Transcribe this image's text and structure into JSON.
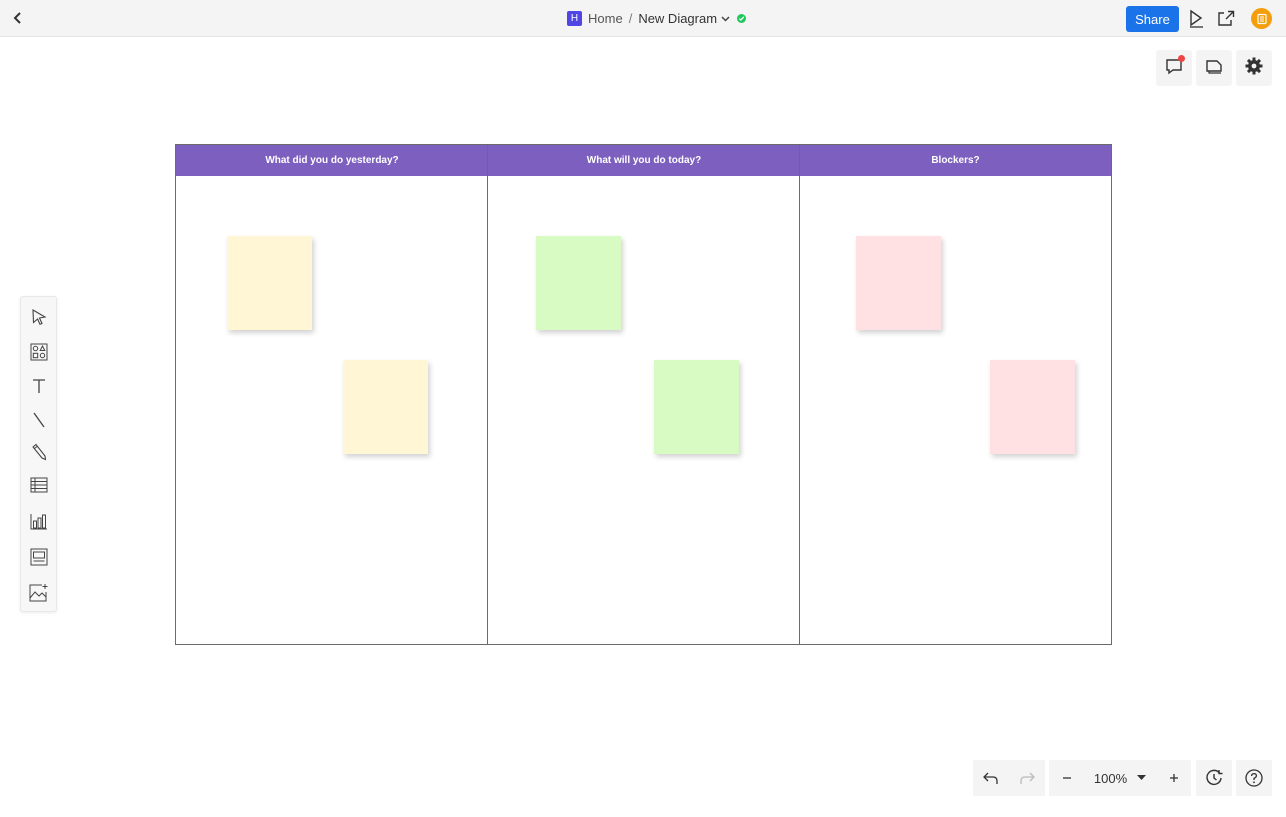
{
  "topbar": {
    "home_badge": "H",
    "home_label": "Home",
    "separator": "/",
    "diagram_title": "New Diagram",
    "share_label": "Share"
  },
  "board": {
    "columns": [
      {
        "header": "What did you do yesterday?",
        "note_color": "#fff6d6"
      },
      {
        "header": "What will you do today?",
        "note_color": "#d8fbc4"
      },
      {
        "header": "Blockers?",
        "note_color": "#ffe0e3"
      }
    ],
    "header_color": "#7c5fbf"
  },
  "zoom": {
    "value": "100%"
  },
  "icons": {
    "topbar": [
      "back-arrow-icon",
      "chevron-down-icon",
      "saved-check-icon",
      "present-icon",
      "export-icon",
      "avatar-icon"
    ],
    "right": [
      "comment-icon",
      "pages-icon",
      "gear-icon"
    ],
    "left": [
      "select-pointer-icon",
      "shapes-icon",
      "text-icon",
      "line-icon",
      "pen-icon",
      "table-icon",
      "chart-icon",
      "frame-icon",
      "image-icon"
    ],
    "bottom": [
      "undo-icon",
      "redo-icon",
      "zoom-out-icon",
      "zoom-dropdown-icon",
      "zoom-in-icon",
      "history-icon",
      "help-icon"
    ]
  }
}
